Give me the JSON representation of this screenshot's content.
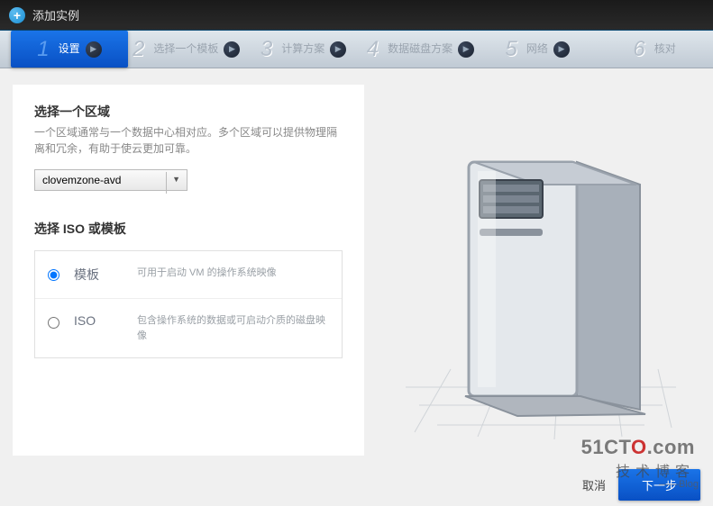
{
  "header": {
    "title": "添加实例"
  },
  "steps": [
    {
      "num": "1",
      "label": "设置",
      "active": true
    },
    {
      "num": "2",
      "label": "选择一个模板"
    },
    {
      "num": "3",
      "label": "计算方案"
    },
    {
      "num": "4",
      "label": "数据磁盘方案"
    },
    {
      "num": "5",
      "label": "网络"
    },
    {
      "num": "6",
      "label": "核对"
    }
  ],
  "region": {
    "title": "选择一个区域",
    "desc": "一个区域通常与一个数据中心相对应。多个区域可以提供物理隔离和冗余，有助于使云更加可靠。",
    "selected": "clovemzone-avd"
  },
  "isoTemplate": {
    "title": "选择 ISO 或模板",
    "options": [
      {
        "key": "template",
        "name": "模板",
        "desc": "可用于启动 VM 的操作系统映像",
        "checked": true
      },
      {
        "key": "iso",
        "name": "ISO",
        "desc": "包含操作系统的数据或可启动介质的磁盘映像",
        "checked": false
      }
    ]
  },
  "footer": {
    "cancel": "取消",
    "next": "下一步"
  },
  "watermark": {
    "line1_a": "51CT",
    "line1_o": "O",
    "line1_b": ".com",
    "line2": "技术博客",
    "line3": "——Blog"
  }
}
